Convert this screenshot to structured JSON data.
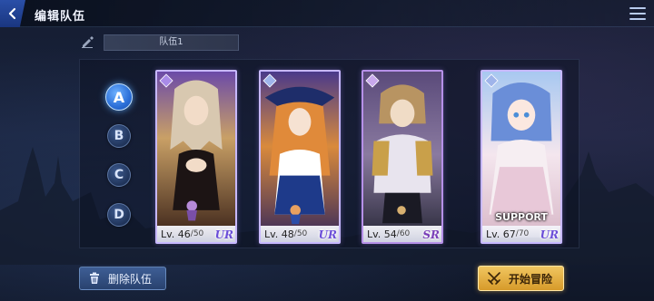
{
  "header": {
    "title": "编辑队伍"
  },
  "team": {
    "name": "队伍1"
  },
  "team_slots": [
    {
      "letter": "A",
      "active": true
    },
    {
      "letter": "B",
      "active": false
    },
    {
      "letter": "C",
      "active": false
    },
    {
      "letter": "D",
      "active": false
    }
  ],
  "cards": [
    {
      "level": "Lv. 46",
      "max": "/50",
      "rarity": "UR"
    },
    {
      "level": "Lv. 48",
      "max": "/50",
      "rarity": "UR"
    },
    {
      "level": "Lv. 54",
      "max": "/60",
      "rarity": "SR"
    },
    {
      "level": "Lv. 67",
      "max": "/70",
      "rarity": "UR",
      "label": "SUPPORT"
    }
  ],
  "buttons": {
    "delete": "删除队伍",
    "start": "开始冒险"
  },
  "colors": {
    "accent": "#2b6fd8",
    "start_button": "#e0a83c",
    "card_border": "#c7b8ff"
  }
}
